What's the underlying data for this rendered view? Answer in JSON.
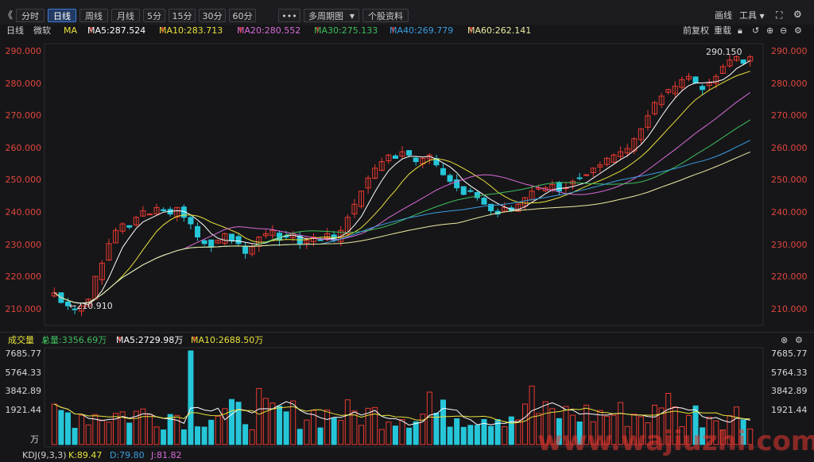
{
  "toolbar": {
    "collapse_label": "《",
    "periods": [
      "分时",
      "日线",
      "周线",
      "月线",
      "5分",
      "15分",
      "30分",
      "60分"
    ],
    "active_index": 1,
    "more_label": "•••",
    "multi_period_label": "多周期图",
    "stock_info_label": "个股资料",
    "draw_label": "画线",
    "tools_label": "工具"
  },
  "legend": {
    "period": "日线",
    "mode": "微软",
    "ma_label": "MA",
    "ma5": "MA5:287.524",
    "ma10": "MA10:283.713",
    "ma20": "MA20:280.552",
    "ma30": "MA30:275.133",
    "ma40": "MA40:269.779",
    "ma60": "MA60:262.141",
    "arrow": "↑",
    "adjust": "前复权",
    "reset": "重载"
  },
  "price_axis": [
    "290.000",
    "280.000",
    "270.000",
    "260.000",
    "250.000",
    "240.000",
    "230.000",
    "220.000",
    "210.000"
  ],
  "price_annotations": {
    "high": "290.150",
    "low": "210.910"
  },
  "volume_legend": {
    "label": "成交量",
    "total": "总量:3356.69万",
    "ma5": "MA5:2729.98万",
    "ma10": "MA10:2688.50万",
    "down_arrow": "↓",
    "up_arrow": "↑"
  },
  "volume_axis": [
    "7685.77",
    "5764.33",
    "3842.89",
    "1921.44"
  ],
  "volume_unit": "万",
  "kdj_legend": {
    "label": "KDJ(9,3,3)",
    "k": "K:89.47",
    "d": "D:79.80",
    "j": "J:81.82"
  },
  "watermark": "www.wajiuzhi.com",
  "colors": {
    "up": "#e8392f",
    "down": "#26c6d9",
    "ma5": "#ffffff",
    "ma10": "#e8e23a",
    "ma20": "#d96ad6",
    "ma30": "#3fbf5a",
    "ma40": "#3a9ee0",
    "ma60": "#eeeca0",
    "background": "#161619"
  },
  "chart_data": {
    "type": "candlestick",
    "title": "日线",
    "price_range": [
      207,
      293
    ],
    "volume_range": [
      0,
      7685.77
    ],
    "closes": [
      217,
      214,
      213,
      212,
      213,
      215,
      222,
      226,
      232,
      236,
      238,
      237,
      240,
      242,
      241,
      243,
      242,
      241,
      243,
      240,
      238,
      234,
      232,
      231,
      233,
      235,
      233,
      232,
      229,
      231,
      234,
      235,
      236,
      233,
      234,
      235,
      232,
      233,
      234,
      233,
      235,
      233,
      236,
      240,
      244,
      248,
      252,
      255,
      257,
      259,
      258,
      260,
      259,
      257,
      258,
      259,
      256,
      253,
      251,
      249,
      247,
      248,
      246,
      244,
      242,
      241,
      243,
      242,
      244,
      246,
      248,
      249,
      249,
      250,
      248,
      249,
      251,
      252,
      253,
      255,
      256,
      258,
      259,
      260,
      261,
      264,
      267,
      271,
      275,
      277,
      279,
      280,
      282,
      283,
      281,
      279,
      281,
      283,
      286,
      288,
      289,
      287,
      289
    ]
  }
}
